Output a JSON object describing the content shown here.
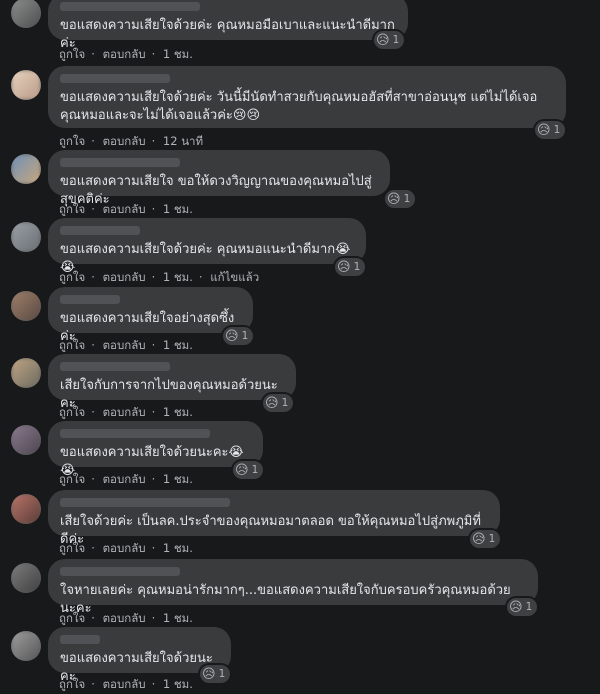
{
  "actions": {
    "like": "ถูกใจ",
    "reply": "ตอบกลับ",
    "edited": "แก้ไขแล้ว"
  },
  "reaction_icon": "sad-face-icon",
  "comments": [
    {
      "text": "ขอแสดงความเสียใจด้วยค่ะ คุณหมอมือเบาและแนะนำดีมากค่ะ",
      "time": "1 ชม.",
      "reaction_count": "1"
    },
    {
      "text": "ขอแสดงความเสียใจด้วยค่ะ วันนี้มีนัดทำสวยกับคุณหมอฮัสที่สาขาอ่อนนุช แต่ไม่ได้เจอคุณหมอและจะไม่ได้เจอแล้วค่ะ",
      "emoji": "😢😢",
      "time": "12 นาที",
      "reaction_count": "1"
    },
    {
      "text": "ขอแสดงความเสียใจ ขอให้ดวงวิญญาณของคุณหมอไปสู่สุขคติค่ะ",
      "time": "1 ชม.",
      "reaction_count": "1"
    },
    {
      "text": "ขอแสดงความเสียใจด้วยค่ะ คุณหมอแนะนำดีมาก",
      "emoji": "😭😭",
      "time": "1 ชม.",
      "reaction_count": "1",
      "edited": true
    },
    {
      "text": "ขอแสดงความเสียใจอย่างสุดซึ้งค่ะ",
      "time": "1 ชม.",
      "reaction_count": "1"
    },
    {
      "text": "เสียใจกับการจากไปของคุณหมอด้วยนะคะ",
      "time": "1 ชม.",
      "reaction_count": "1"
    },
    {
      "text": "ขอแสดงความเสียใจด้วยนะคะ",
      "emoji": "😭😭",
      "time": "1 ชม.",
      "reaction_count": "1"
    },
    {
      "text": "เสียใจด้วยค่ะ เป็นลค.ประจำของคุณหมอมาตลอด ขอให้คุณหมอไปสู่ภพภูมิที่ดีค่ะ",
      "time": "1 ชม.",
      "reaction_count": "1"
    },
    {
      "text": "ใจหายเลยค่ะ คุณหมอน่ารักมากๆ...ขอแสดงความเสียใจกับครอบครัวคุณหมอด้วยนะคะ",
      "time": "1 ชม.",
      "reaction_count": "1"
    },
    {
      "text": "ขอแสดงความเสียใจด้วยนะคะ",
      "time": "1 ชม.",
      "reaction_count": "1"
    }
  ]
}
